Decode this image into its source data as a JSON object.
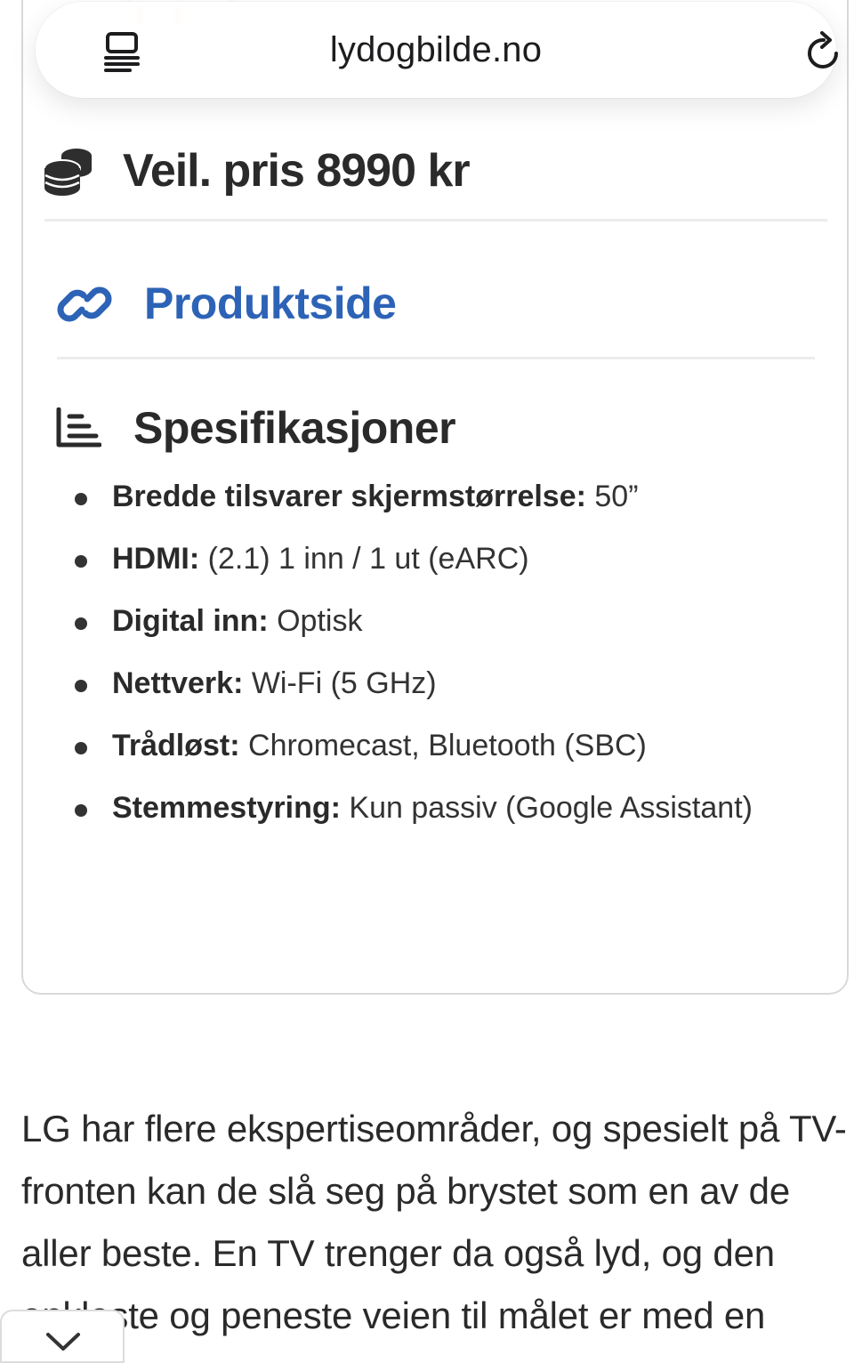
{
  "browser": {
    "url": "lydogbilde.no",
    "reader_icon": "reader-mode-icon",
    "reload_icon": "reload-icon"
  },
  "price": {
    "icon": "coins-icon",
    "text": "Veil. pris 8990 kr"
  },
  "product_link": {
    "icon": "link-icon",
    "label": "Produktside",
    "color": "#2d63b6"
  },
  "specs": {
    "icon": "list-icon",
    "title": "Spesifikasjoner",
    "items": [
      {
        "key": "Bredde tilsvarer skjermstørrelse:",
        "value": " 50”"
      },
      {
        "key": "HDMI:",
        "value": " (2.1) 1 inn / 1 ut (eARC)"
      },
      {
        "key": "Digital inn:",
        "value": " Optisk"
      },
      {
        "key": "Nettverk:",
        "value": " Wi-Fi (5 GHz)"
      },
      {
        "key": "Trådløst:",
        "value": " Chromecast, Bluetooth (SBC)"
      },
      {
        "key": "Stemmestyring:",
        "value": " Kun passiv (Google Assistant)"
      }
    ]
  },
  "article": {
    "text": "LG har flere ekspertiseområder, og spesielt på TV-fronten kan de slå seg på brystet som en av de aller beste. En TV trenger da også lyd, og den enkleste og peneste veien til målet er med en"
  },
  "bottom_tab": {
    "icon": "chevron-down-icon"
  }
}
